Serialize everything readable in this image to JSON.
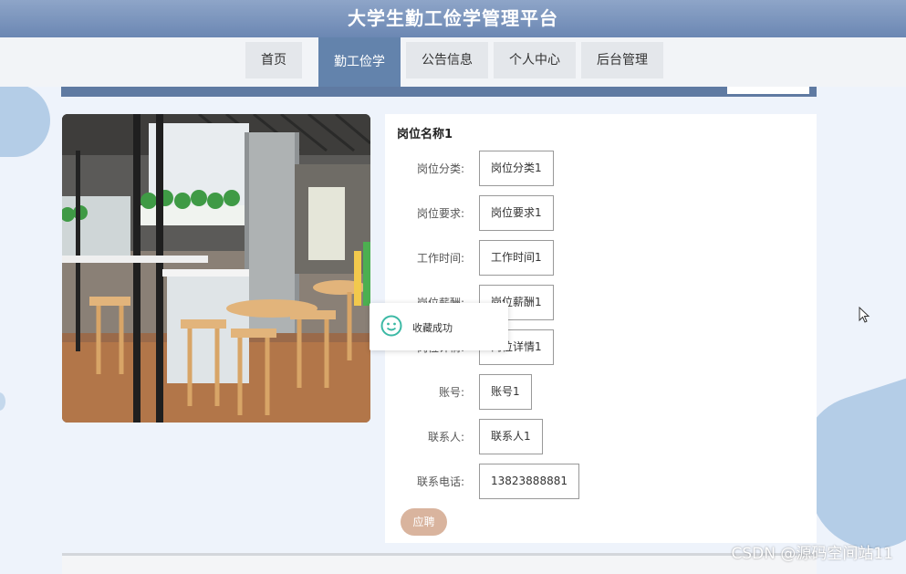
{
  "header": {
    "title": "大学生勤工俭学管理平台"
  },
  "nav": {
    "items": [
      {
        "label": "首页",
        "key": "home"
      },
      {
        "label": "勤工俭学",
        "key": "work-study",
        "active": true
      },
      {
        "label": "公告信息",
        "key": "notice"
      },
      {
        "label": "个人中心",
        "key": "profile"
      },
      {
        "label": "后台管理",
        "key": "admin"
      }
    ]
  },
  "detail": {
    "position_name": "岗位名称1",
    "fields": [
      {
        "label": "岗位分类:",
        "value": "岗位分类1"
      },
      {
        "label": "岗位要求:",
        "value": "岗位要求1"
      },
      {
        "label": "工作时间:",
        "value": "工作时间1"
      },
      {
        "label": "岗位薪酬:",
        "value": "岗位薪酬1"
      },
      {
        "label": "岗位详情:",
        "value": "岗位详情1"
      },
      {
        "label": "账号:",
        "value": "账号1"
      },
      {
        "label": "联系人:",
        "value": "联系人1"
      },
      {
        "label": "联系电话:",
        "value": "13823888881"
      }
    ],
    "apply_label": "应聘"
  },
  "toast": {
    "message": "收藏成功"
  },
  "watermark": "CSDN @源码空间站11",
  "colors": {
    "header": "#6b87b3",
    "nav_active": "#6383ac",
    "apply_button": "#d9b49e",
    "toast_icon": "#3cb9a5"
  }
}
